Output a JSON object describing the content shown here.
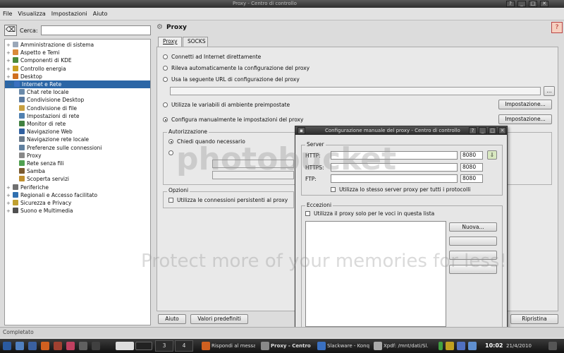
{
  "window": {
    "title": "Proxy - Centro di controllo"
  },
  "menubar": [
    "File",
    "Visualizza",
    "Impostazioni",
    "Aiuto"
  ],
  "search": {
    "label": "Cerca:",
    "value": ""
  },
  "tree": [
    {
      "label": "Amministrazione di sistema",
      "level": 0,
      "color": "#9aa7b8"
    },
    {
      "label": "Aspetto e Temi",
      "level": 0,
      "color": "#d98a3a"
    },
    {
      "label": "Componenti di KDE",
      "level": 0,
      "color": "#4a8a3a"
    },
    {
      "label": "Controllo energia",
      "level": 0,
      "color": "#caa020"
    },
    {
      "label": "Desktop",
      "level": 0,
      "color": "#d07020"
    },
    {
      "label": "Internet e Rete",
      "level": 0,
      "color": "#3a70c0",
      "selected": true
    },
    {
      "label": "Chat rete locale",
      "level": 1,
      "color": "#6a8aaa"
    },
    {
      "label": "Condivisione Desktop",
      "level": 1,
      "color": "#5a7aa0"
    },
    {
      "label": "Condivisione di file",
      "level": 1,
      "color": "#c8a040"
    },
    {
      "label": "Impostazioni di rete",
      "level": 1,
      "color": "#5080b0"
    },
    {
      "label": "Monitor di rete",
      "level": 1,
      "color": "#408040"
    },
    {
      "label": "Navigazione Web",
      "level": 1,
      "color": "#3060a0"
    },
    {
      "label": "Navigazione rete locale",
      "level": 1,
      "color": "#6a7a8a"
    },
    {
      "label": "Preferenze sulle connessioni",
      "level": 1,
      "color": "#6080a0"
    },
    {
      "label": "Proxy",
      "level": 1,
      "color": "#888888"
    },
    {
      "label": "Rete senza fili",
      "level": 1,
      "color": "#50a050"
    },
    {
      "label": "Samba",
      "level": 1,
      "color": "#7a5a30"
    },
    {
      "label": "Scoperta servizi",
      "level": 1,
      "color": "#c09030"
    },
    {
      "label": "Periferiche",
      "level": 0,
      "color": "#707070"
    },
    {
      "label": "Regionali e Accesso facilitato",
      "level": 0,
      "color": "#3070b0"
    },
    {
      "label": "Sicurezza e Privacy",
      "level": 0,
      "color": "#c0a030"
    },
    {
      "label": "Suono e Multimedia",
      "level": 0,
      "color": "#505050"
    }
  ],
  "panel": {
    "title": "Proxy",
    "tabs": [
      "Proxy",
      "SOCKS"
    ],
    "opt_direct": "Connetti ad Internet direttamente",
    "opt_auto": "Rileva automaticamente la configurazione del proxy",
    "opt_url": "Usa la seguente URL di configurazione del proxy",
    "opt_env": "Utilizza le variabili di ambiente preimpostate",
    "opt_manual": "Configura manualmente le impostazioni del proxy",
    "setup_button": "Impostazione...",
    "auth_group": "Autorizzazione",
    "auth_ask": "Chiedi quando necessario",
    "options_group": "Opzioni",
    "persistent": "Utilizza le connessioni persistenti al proxy",
    "help_button": "Aiuto",
    "defaults_button": "Valori predefiniti",
    "reset_button": "Ripristina"
  },
  "dialog": {
    "title": "Configurazione manuale del proxy - Centro di controllo",
    "servers_group": "Server",
    "http_label": "HTTP:",
    "https_label": "HTTPS:",
    "ftp_label": "FTP:",
    "http_port": "8080",
    "https_port": "8080",
    "ftp_port": "8080",
    "same_server": "Utilizza lo stesso server proxy per tutti i protocolli",
    "exceptions_group": "Eccezioni",
    "only_list": "Utilizza il proxy solo per le voci in questa lista",
    "new_button": "Nuova..."
  },
  "status": "Completato",
  "taskbar": {
    "desktops": [
      "3",
      "4"
    ],
    "tasks": [
      "Rispondi al messa...",
      "Proxy - Centro",
      "Slackware - Konq...",
      "Xpdf: /mnt/dati/Sl..."
    ],
    "clock": "10:02",
    "date": "21/4/2010"
  },
  "watermark": {
    "text": "photobucket",
    "tagline": "Protect more of your memories for less!"
  }
}
